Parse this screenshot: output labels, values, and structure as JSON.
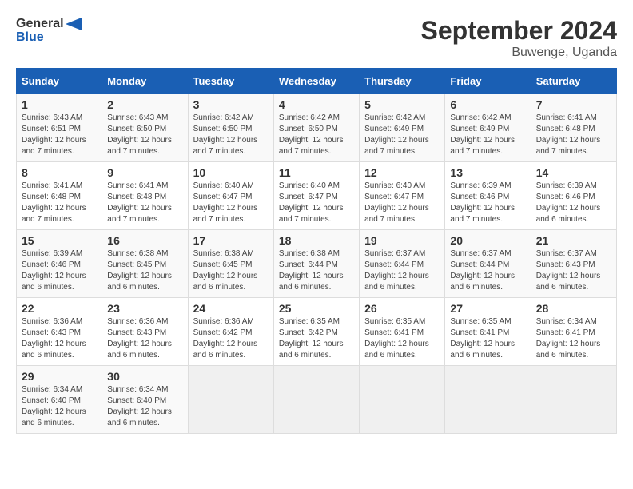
{
  "header": {
    "logo_line1": "General",
    "logo_line2": "Blue",
    "month": "September 2024",
    "location": "Buwenge, Uganda"
  },
  "days_of_week": [
    "Sunday",
    "Monday",
    "Tuesday",
    "Wednesday",
    "Thursday",
    "Friday",
    "Saturday"
  ],
  "weeks": [
    [
      {
        "day": "1",
        "info": "Sunrise: 6:43 AM\nSunset: 6:51 PM\nDaylight: 12 hours and 7 minutes."
      },
      {
        "day": "2",
        "info": "Sunrise: 6:43 AM\nSunset: 6:50 PM\nDaylight: 12 hours and 7 minutes."
      },
      {
        "day": "3",
        "info": "Sunrise: 6:42 AM\nSunset: 6:50 PM\nDaylight: 12 hours and 7 minutes."
      },
      {
        "day": "4",
        "info": "Sunrise: 6:42 AM\nSunset: 6:50 PM\nDaylight: 12 hours and 7 minutes."
      },
      {
        "day": "5",
        "info": "Sunrise: 6:42 AM\nSunset: 6:49 PM\nDaylight: 12 hours and 7 minutes."
      },
      {
        "day": "6",
        "info": "Sunrise: 6:42 AM\nSunset: 6:49 PM\nDaylight: 12 hours and 7 minutes."
      },
      {
        "day": "7",
        "info": "Sunrise: 6:41 AM\nSunset: 6:48 PM\nDaylight: 12 hours and 7 minutes."
      }
    ],
    [
      {
        "day": "8",
        "info": "Sunrise: 6:41 AM\nSunset: 6:48 PM\nDaylight: 12 hours and 7 minutes."
      },
      {
        "day": "9",
        "info": "Sunrise: 6:41 AM\nSunset: 6:48 PM\nDaylight: 12 hours and 7 minutes."
      },
      {
        "day": "10",
        "info": "Sunrise: 6:40 AM\nSunset: 6:47 PM\nDaylight: 12 hours and 7 minutes."
      },
      {
        "day": "11",
        "info": "Sunrise: 6:40 AM\nSunset: 6:47 PM\nDaylight: 12 hours and 7 minutes."
      },
      {
        "day": "12",
        "info": "Sunrise: 6:40 AM\nSunset: 6:47 PM\nDaylight: 12 hours and 7 minutes."
      },
      {
        "day": "13",
        "info": "Sunrise: 6:39 AM\nSunset: 6:46 PM\nDaylight: 12 hours and 7 minutes."
      },
      {
        "day": "14",
        "info": "Sunrise: 6:39 AM\nSunset: 6:46 PM\nDaylight: 12 hours and 6 minutes."
      }
    ],
    [
      {
        "day": "15",
        "info": "Sunrise: 6:39 AM\nSunset: 6:46 PM\nDaylight: 12 hours and 6 minutes."
      },
      {
        "day": "16",
        "info": "Sunrise: 6:38 AM\nSunset: 6:45 PM\nDaylight: 12 hours and 6 minutes."
      },
      {
        "day": "17",
        "info": "Sunrise: 6:38 AM\nSunset: 6:45 PM\nDaylight: 12 hours and 6 minutes."
      },
      {
        "day": "18",
        "info": "Sunrise: 6:38 AM\nSunset: 6:44 PM\nDaylight: 12 hours and 6 minutes."
      },
      {
        "day": "19",
        "info": "Sunrise: 6:37 AM\nSunset: 6:44 PM\nDaylight: 12 hours and 6 minutes."
      },
      {
        "day": "20",
        "info": "Sunrise: 6:37 AM\nSunset: 6:44 PM\nDaylight: 12 hours and 6 minutes."
      },
      {
        "day": "21",
        "info": "Sunrise: 6:37 AM\nSunset: 6:43 PM\nDaylight: 12 hours and 6 minutes."
      }
    ],
    [
      {
        "day": "22",
        "info": "Sunrise: 6:36 AM\nSunset: 6:43 PM\nDaylight: 12 hours and 6 minutes."
      },
      {
        "day": "23",
        "info": "Sunrise: 6:36 AM\nSunset: 6:43 PM\nDaylight: 12 hours and 6 minutes."
      },
      {
        "day": "24",
        "info": "Sunrise: 6:36 AM\nSunset: 6:42 PM\nDaylight: 12 hours and 6 minutes."
      },
      {
        "day": "25",
        "info": "Sunrise: 6:35 AM\nSunset: 6:42 PM\nDaylight: 12 hours and 6 minutes."
      },
      {
        "day": "26",
        "info": "Sunrise: 6:35 AM\nSunset: 6:41 PM\nDaylight: 12 hours and 6 minutes."
      },
      {
        "day": "27",
        "info": "Sunrise: 6:35 AM\nSunset: 6:41 PM\nDaylight: 12 hours and 6 minutes."
      },
      {
        "day": "28",
        "info": "Sunrise: 6:34 AM\nSunset: 6:41 PM\nDaylight: 12 hours and 6 minutes."
      }
    ],
    [
      {
        "day": "29",
        "info": "Sunrise: 6:34 AM\nSunset: 6:40 PM\nDaylight: 12 hours and 6 minutes."
      },
      {
        "day": "30",
        "info": "Sunrise: 6:34 AM\nSunset: 6:40 PM\nDaylight: 12 hours and 6 minutes."
      },
      {
        "day": "",
        "info": ""
      },
      {
        "day": "",
        "info": ""
      },
      {
        "day": "",
        "info": ""
      },
      {
        "day": "",
        "info": ""
      },
      {
        "day": "",
        "info": ""
      }
    ]
  ]
}
